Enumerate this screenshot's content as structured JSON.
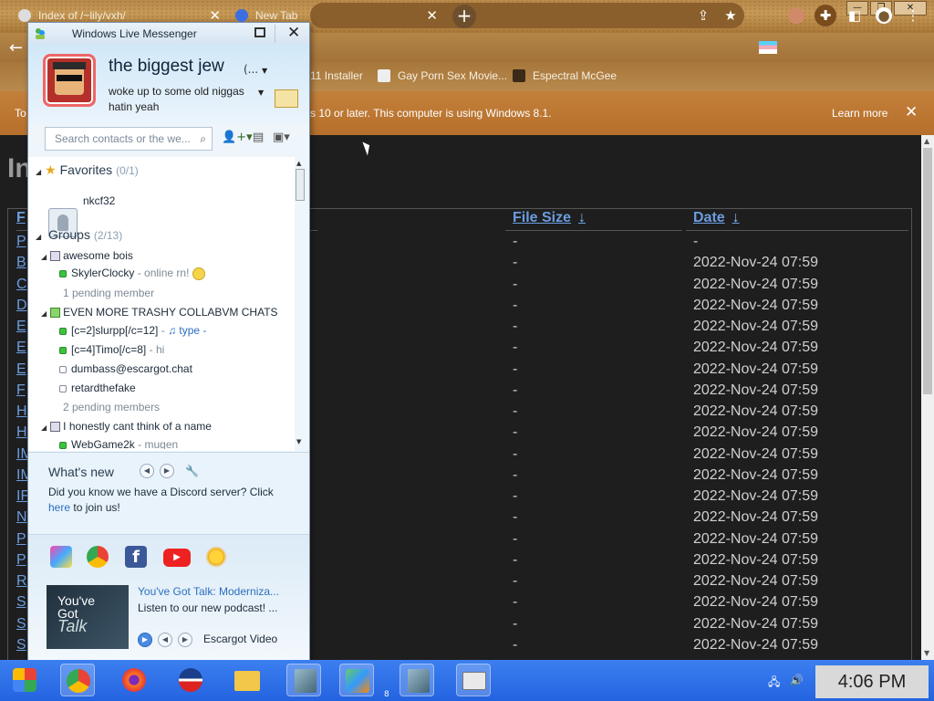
{
  "browser": {
    "tabs": [
      {
        "title": "Index of /~lily/vxh/"
      },
      {
        "title": "New Tab"
      }
    ],
    "bookmarks": [
      {
        "label": "11 Installer"
      },
      {
        "label": "Gay Porn Sex Movie..."
      },
      {
        "label": "Espectral McGee"
      }
    ],
    "infobar": {
      "message_left": "To",
      "message_right": "s 10 or later. This computer is using Windows 8.1.",
      "learn_more": "Learn more"
    },
    "window_controls": {
      "minimize": "—",
      "restore": "❐",
      "close": "✕"
    }
  },
  "page": {
    "heading": "In",
    "columns": {
      "name": "F",
      "size": "File Size",
      "date": "Date",
      "sort_arrow": "↓"
    },
    "rows": [
      {
        "name": "P",
        "size": "-",
        "date": "-"
      },
      {
        "name": "B",
        "size": "-",
        "date": "2022-Nov-24 07:59"
      },
      {
        "name": "C",
        "size": "-",
        "date": "2022-Nov-24 07:59"
      },
      {
        "name": "D",
        "size": "-",
        "date": "2022-Nov-24 07:59"
      },
      {
        "name": "E",
        "size": "-",
        "date": "2022-Nov-24 07:59"
      },
      {
        "name": "E",
        "size": "-",
        "date": "2022-Nov-24 07:59"
      },
      {
        "name": "E",
        "size": "-",
        "date": "2022-Nov-24 07:59"
      },
      {
        "name": "F",
        "size": "-",
        "date": "2022-Nov-24 07:59"
      },
      {
        "name": "H",
        "size": "-",
        "date": "2022-Nov-24 07:59"
      },
      {
        "name": "H",
        "size": "-",
        "date": "2022-Nov-24 07:59"
      },
      {
        "name": "IM",
        "size": "-",
        "date": "2022-Nov-24 07:59"
      },
      {
        "name": "IM",
        "size": "-",
        "date": "2022-Nov-24 07:59"
      },
      {
        "name": "IF",
        "size": "-",
        "date": "2022-Nov-24 07:59"
      },
      {
        "name": "N",
        "size": "-",
        "date": "2022-Nov-24 07:59"
      },
      {
        "name": "P",
        "size": "-",
        "date": "2022-Nov-24 07:59"
      },
      {
        "name": "P",
        "size": "-",
        "date": "2022-Nov-24 07:59"
      },
      {
        "name": "R",
        "size": "-",
        "date": "2022-Nov-24 07:59"
      },
      {
        "name": "S",
        "size": "-",
        "date": "2022-Nov-24 07:59"
      },
      {
        "name": "S",
        "size": "-",
        "date": "2022-Nov-24 07:59"
      },
      {
        "name": "S",
        "size": "-",
        "date": "2022-Nov-24 07:59"
      }
    ]
  },
  "messenger": {
    "title": "Windows Live Messenger",
    "display_name": "the biggest jew",
    "display_name_more": "(...",
    "personal_message": "woke up to some old niggas hatin yeah",
    "search_placeholder": "Search contacts or the we...",
    "favorites": {
      "label": "Favorites",
      "count": "(0/1)",
      "contacts": [
        "nkcf32"
      ]
    },
    "groups": {
      "label": "Groups",
      "count": "(2/13)",
      "group1": {
        "name": "awesome bois",
        "contact1_name": "SkylerClocky",
        "contact1_status": "online rn!",
        "pending": "1 pending member"
      },
      "group2": {
        "name": "EVEN MORE TRASHY COLLABVM CHATS",
        "c1_name": "[c=2]slurpp[/c=12]",
        "c1_status": "type -",
        "c2_name": "[c=4]Timo[/c=8]",
        "c2_status": "hi",
        "c3_name": "dumbass@escargot.chat",
        "c4_name": "retardthefake",
        "pending": "2 pending members"
      },
      "group3": {
        "name": "I honestly cant think of a name",
        "c1_name": "WebGame2k",
        "c1_status": "mugen"
      }
    },
    "whats_new": {
      "title": "What's new",
      "text_before": "Did you know we have a Discord server? Click ",
      "link": "here",
      "text_after": " to join us!"
    },
    "promo": {
      "image_text_1": "You've",
      "image_text_2": "Got",
      "image_text_3": "Talk",
      "title": "You've Got Talk: Moderniza...",
      "subtitle": "Listen to our new podcast! ...",
      "source": "Escargot Video"
    },
    "app_icons": [
      "butterfly-icon",
      "c-icon",
      "facebook-icon",
      "youtube-icon",
      "sun-icon"
    ]
  },
  "taskbar": {
    "clock": "4:06 PM",
    "badge": "8"
  },
  "colors": {
    "taskbar": "#2463e0",
    "link": "#6b9de0",
    "infobar": "#c3803a",
    "messenger_bg": "#eef5fb"
  }
}
